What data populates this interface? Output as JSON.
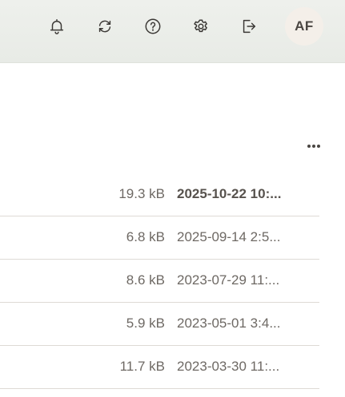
{
  "header": {
    "icons": [
      "bell-icon",
      "refresh-icon",
      "help-icon",
      "gear-icon",
      "logout-icon"
    ],
    "avatar_initials": "AF"
  },
  "table": {
    "more_icon": "ellipsis-icon",
    "rows": [
      {
        "size": "19.3 kB",
        "date": "2025-10-22 10:...",
        "unread": true
      },
      {
        "size": "6.8 kB",
        "date": "2025-09-14 2:5...",
        "unread": false
      },
      {
        "size": "8.6 kB",
        "date": "2023-07-29 11:...",
        "unread": false
      },
      {
        "size": "5.9 kB",
        "date": "2023-05-01 3:4...",
        "unread": false
      },
      {
        "size": "11.7 kB",
        "date": "2023-03-30 11:...",
        "unread": false
      }
    ]
  }
}
